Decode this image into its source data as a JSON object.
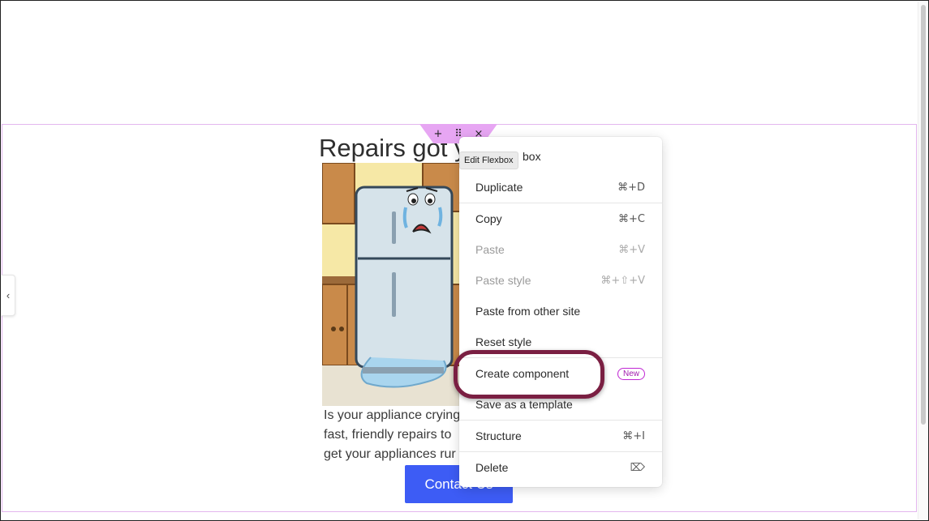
{
  "page": {
    "heading": "Repairs got y",
    "body_lines": [
      "Is your appliance crying",
      "fast, friendly repairs to",
      "get your appliances rur"
    ],
    "contact_button": "Contact Us"
  },
  "toolbar": {
    "add_icon": "+",
    "drag_icon": "⠿",
    "close_icon": "×",
    "tooltip": "Edit Flexbox",
    "side_toggle_icon": "‹"
  },
  "context_menu": {
    "first_item_partial": "box",
    "items": [
      {
        "label": "Duplicate",
        "shortcut": "⌘+D",
        "enabled": true
      },
      {
        "label": "Copy",
        "shortcut": "⌘+C",
        "enabled": true
      },
      {
        "label": "Paste",
        "shortcut": "⌘+V",
        "enabled": false
      },
      {
        "label": "Paste style",
        "shortcut": "⌘+⇧+V",
        "enabled": false
      },
      {
        "label": "Paste from other site",
        "shortcut": "",
        "enabled": true
      },
      {
        "label": "Reset style",
        "shortcut": "",
        "enabled": true
      },
      {
        "label": "Create component",
        "badge": "New",
        "enabled": true
      },
      {
        "label": "Save as a template",
        "shortcut": "",
        "enabled": true
      },
      {
        "label": "Structure",
        "shortcut": "⌘+I",
        "enabled": true
      },
      {
        "label": "Delete",
        "shortcut": "⌦",
        "enabled": true
      }
    ]
  },
  "colors": {
    "accent_button": "#3d5cf5",
    "selection_outline": "#e3b6ee",
    "toolbar_tab": "#e7a6f3",
    "highlight_ring": "#7a1f42",
    "badge": "#c026d3"
  },
  "image": {
    "subject": "crying-refrigerator-illustration"
  }
}
